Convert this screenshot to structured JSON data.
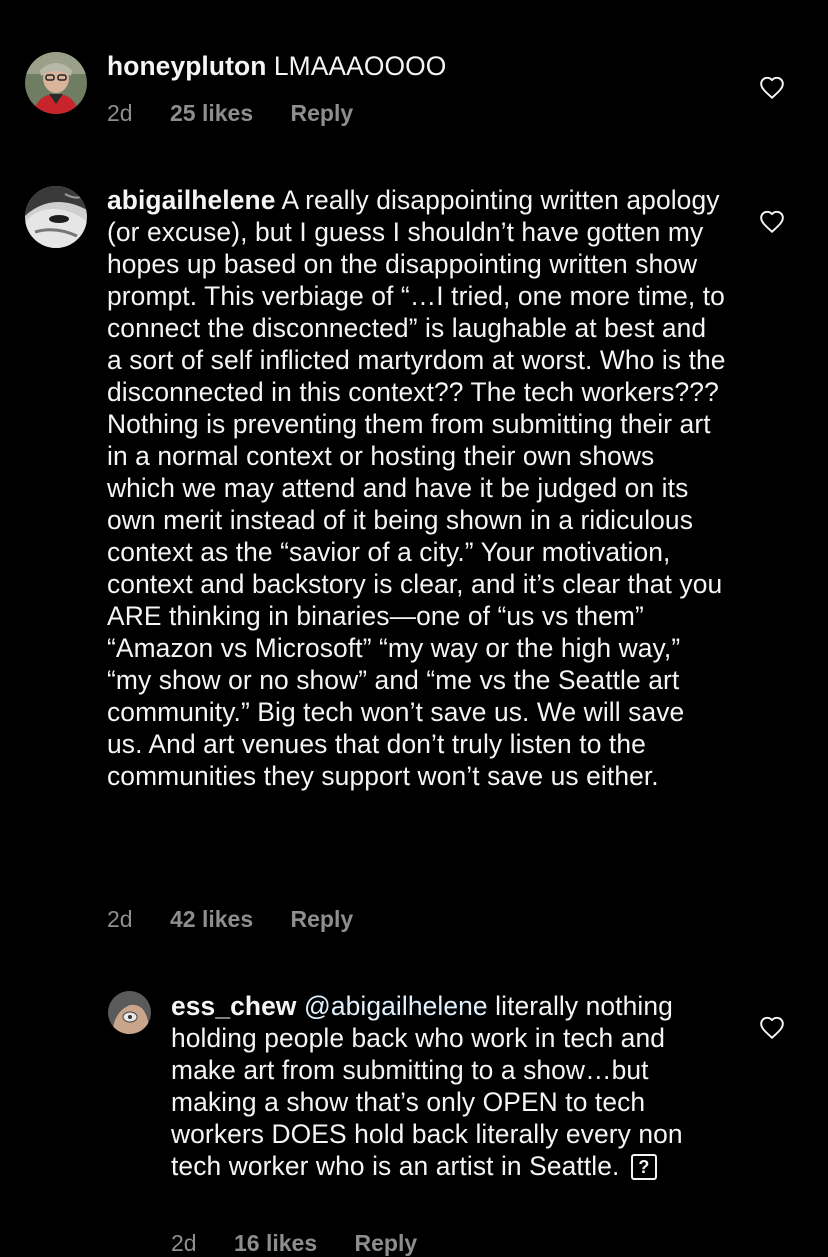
{
  "comments": [
    {
      "username": "honeypluton",
      "text": "LMAAAOOOO",
      "time": "2d",
      "likes": "25 likes",
      "reply": "Reply"
    },
    {
      "username": "abigailhelene",
      "text": "A really disappointing written apology (or excuse), but I guess I shouldn’t have gotten my hopes up based on the disappointing written show prompt. This verbiage of “…I tried, one more time, to connect the disconnected” is laughable at best and a sort of self inflicted martyrdom at worst. Who is the disconnected in this context?? The tech workers??? Nothing is preventing them from submitting their art in a normal context or hosting their own shows which we may attend and have it be judged on its own merit instead of it being shown in a ridiculous context as the “savior of a city.” Your motivation, context and backstory is clear, and it’s clear that you ARE thinking in binaries—one of “us vs them” “Amazon vs Microsoft” “my way or the high way,” “my show or no show” and “me vs the Seattle art community.” Big tech won’t save us. We will save us. And art venues that don’t truly listen to the communities they support won’t save us either.",
      "time": "2d",
      "likes": "42 likes",
      "reply": "Reply"
    },
    {
      "username": "ess_chew",
      "mention": "@abigailhelene",
      "text": "literally nothing holding people back who work in tech and make art from submitting to a show…but making a show that’s only OPEN to tech workers DOES hold back literally every non tech worker who is an artist in Seattle.",
      "emoji": "?",
      "time": "2d",
      "likes": "16 likes",
      "reply": "Reply"
    }
  ],
  "icons": {
    "heart": "heart-outline-icon"
  },
  "colors": {
    "background": "#000000",
    "text": "#f5f5f5",
    "meta": "#8e8e8e",
    "mention": "#e0f1ff"
  }
}
